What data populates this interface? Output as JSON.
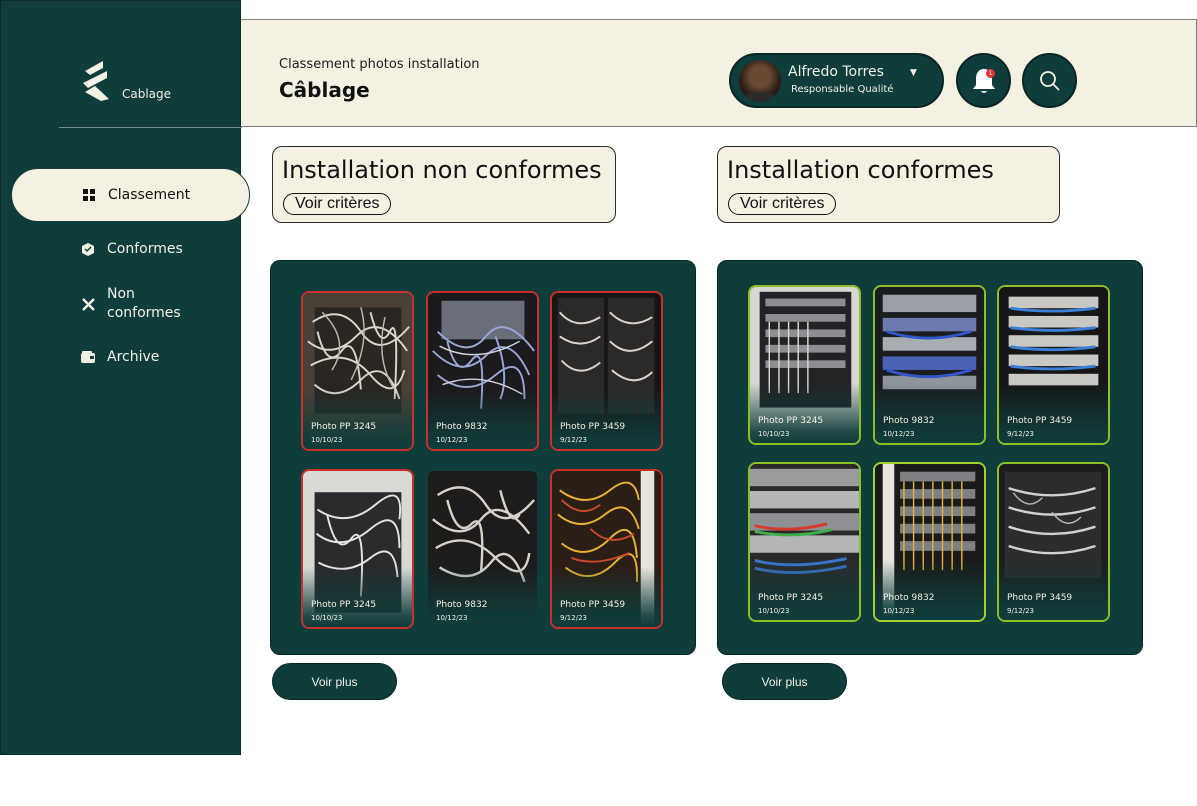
{
  "sidebar": {
    "brand": "Cablage",
    "items": [
      {
        "label": "Classement",
        "icon": "grid-icon",
        "active": true
      },
      {
        "label": "Conformes",
        "icon": "package-check-icon"
      },
      {
        "label": "Non\nconformes",
        "icon": "x-icon"
      },
      {
        "label": "Archive",
        "icon": "wallet-icon"
      }
    ]
  },
  "header": {
    "subtitle": "Classement photos installation",
    "title": "Câblage",
    "user": {
      "name": "Alfredo Torres",
      "role": "Responsable Qualité"
    },
    "notification_count": "1"
  },
  "sections": {
    "non_conformes": {
      "title": "Installation non conformes",
      "criteria_label": "Voir critères",
      "more_label": "Voir plus",
      "photos": [
        {
          "name": "Photo PP 3245",
          "date": "10/10/23"
        },
        {
          "name": "Photo 9832",
          "date": "10/12/23"
        },
        {
          "name": "Photo PP 3459",
          "date": "9/12/23"
        },
        {
          "name": "Photo PP 3245",
          "date": "10/10/23"
        },
        {
          "name": "Photo 9832",
          "date": "10/12/23"
        },
        {
          "name": "Photo PP 3459",
          "date": "9/12/23"
        }
      ]
    },
    "conformes": {
      "title": "Installation conformes",
      "criteria_label": "Voir critères",
      "more_label": "Voir plus",
      "photos": [
        {
          "name": "Photo PP 3245",
          "date": "10/10/23"
        },
        {
          "name": "Photo 9832",
          "date": "10/12/23"
        },
        {
          "name": "Photo PP 3459",
          "date": "9/12/23"
        },
        {
          "name": "Photo PP 3245",
          "date": "10/10/23"
        },
        {
          "name": "Photo 9832",
          "date": "10/12/23"
        },
        {
          "name": "Photo PP 3459",
          "date": "9/12/23"
        }
      ]
    }
  },
  "colors": {
    "primary": "#0f3d3b",
    "cream": "#f4f1e3",
    "non_conforme_border": "#c9302c",
    "conforme_border": "#8cbf26"
  }
}
